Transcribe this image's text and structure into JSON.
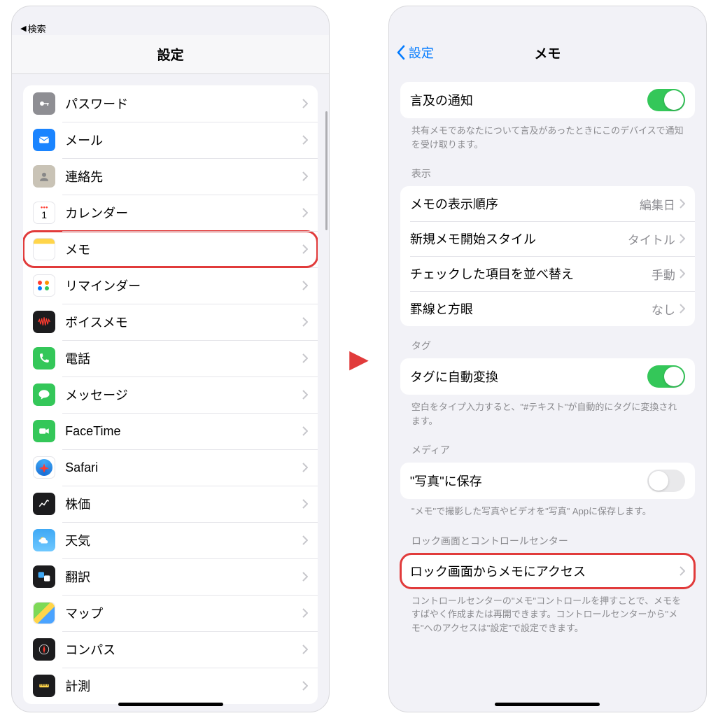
{
  "left": {
    "breadcrumb": "検索",
    "title": "設定",
    "rows": [
      {
        "id": "passwords",
        "label": "パスワード"
      },
      {
        "id": "mail",
        "label": "メール"
      },
      {
        "id": "contacts",
        "label": "連絡先"
      },
      {
        "id": "calendar",
        "label": "カレンダー"
      },
      {
        "id": "notes",
        "label": "メモ",
        "highlight": true
      },
      {
        "id": "reminders",
        "label": "リマインダー"
      },
      {
        "id": "voicememos",
        "label": "ボイスメモ"
      },
      {
        "id": "phone",
        "label": "電話"
      },
      {
        "id": "messages",
        "label": "メッセージ"
      },
      {
        "id": "facetime",
        "label": "FaceTime"
      },
      {
        "id": "safari",
        "label": "Safari"
      },
      {
        "id": "stocks",
        "label": "株価"
      },
      {
        "id": "weather",
        "label": "天気"
      },
      {
        "id": "translate",
        "label": "翻訳"
      },
      {
        "id": "maps",
        "label": "マップ"
      },
      {
        "id": "compass",
        "label": "コンパス"
      },
      {
        "id": "measure",
        "label": "計測"
      }
    ]
  },
  "right": {
    "back": "設定",
    "title": "メモ",
    "mention": {
      "label": "言及の通知",
      "footer": "共有メモであなたについて言及があったときにこのデバイスで通知を受け取ります。"
    },
    "display": {
      "header": "表示",
      "order": {
        "label": "メモの表示順序",
        "value": "編集日"
      },
      "newstyle": {
        "label": "新規メモ開始スタイル",
        "value": "タイトル"
      },
      "sortchecked": {
        "label": "チェックした項目を並べ替え",
        "value": "手動"
      },
      "lines": {
        "label": "罫線と方眼",
        "value": "なし"
      }
    },
    "tags": {
      "header": "タグ",
      "auto": {
        "label": "タグに自動変換"
      },
      "footer": "空白をタイプ入力すると、\"#テキスト\"が自動的にタグに変換されます。"
    },
    "media": {
      "header": "メディア",
      "save": {
        "label": "\"写真\"に保存"
      },
      "footer": "\"メモ\"で撮影した写真やビデオを\"写真\" Appに保存します。"
    },
    "lock": {
      "header": "ロック画面とコントロールセンター",
      "access": {
        "label": "ロック画面からメモにアクセス"
      },
      "footer": "コントロールセンターの\"メモ\"コントロールを押すことで、メモをすばやく作成または再開できます。コントロールセンターから\"メモ\"へのアクセスは\"設定\"で設定できます。"
    }
  }
}
